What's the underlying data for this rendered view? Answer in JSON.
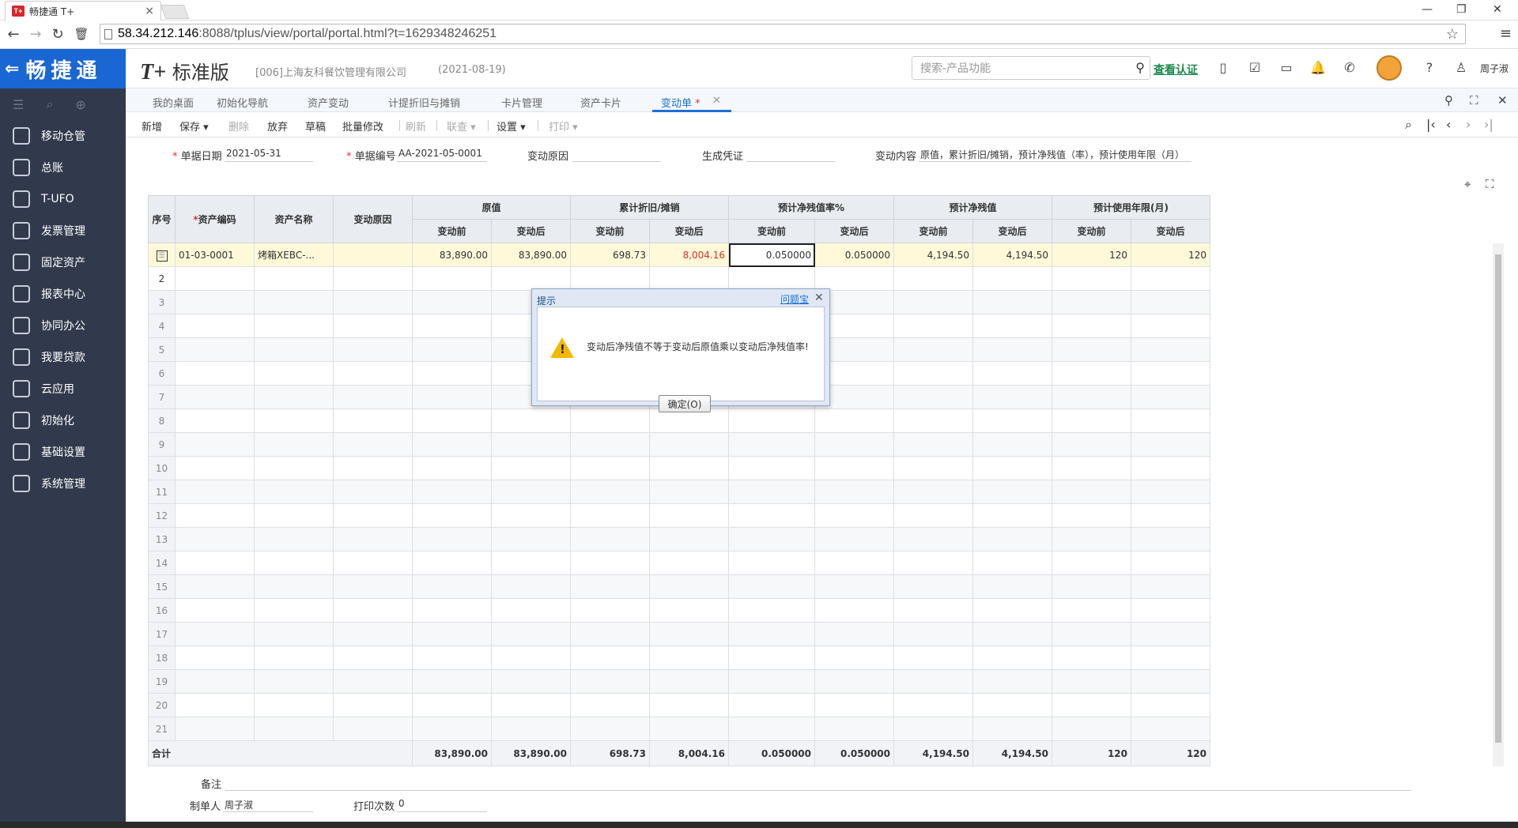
{
  "browser": {
    "tab_title": "畅捷通 T+",
    "favicon_text": "T+",
    "url_host": "58.34.212.146",
    "url_rest": ":8088/tplus/view/portal/portal.html?t=1629348246251"
  },
  "sidebar": {
    "logo": "畅捷通",
    "items": [
      {
        "label": "移动仓管",
        "icon": "warehouse-icon"
      },
      {
        "label": "总账",
        "icon": "ledger-icon"
      },
      {
        "label": "T-UFO",
        "icon": "ufo-icon"
      },
      {
        "label": "发票管理",
        "icon": "invoice-icon"
      },
      {
        "label": "固定资产",
        "icon": "bank-icon"
      },
      {
        "label": "报表中心",
        "icon": "chart-icon"
      },
      {
        "label": "协同办公",
        "icon": "collab-icon"
      },
      {
        "label": "我要贷款",
        "icon": "money-icon"
      },
      {
        "label": "云应用",
        "icon": "cloud-icon"
      },
      {
        "label": "初始化",
        "icon": "refresh-icon"
      },
      {
        "label": "基础设置",
        "icon": "settings-icon"
      },
      {
        "label": "系统管理",
        "icon": "monitor-icon"
      }
    ]
  },
  "header": {
    "product_t": "T+",
    "product_name": "标准版",
    "company": "[006]上海友科餐饮管理有限公司",
    "date": "(2021-08-19)",
    "search_placeholder": "搜索-产品功能",
    "verify": "查看认证",
    "user": "周子淑"
  },
  "worktabs": {
    "tabs": [
      "我的桌面",
      "初始化导航",
      "资产变动",
      "计提折旧与摊销",
      "卡片管理",
      "资产卡片",
      "变动单"
    ],
    "active_star": "*"
  },
  "toolbar": {
    "new": "新增",
    "save": "保存",
    "delete": "删除",
    "discard": "放弃",
    "draft": "草稿",
    "batch_edit": "批量修改",
    "refresh": "刷新",
    "link": "联查",
    "settings": "设置",
    "print": "打印"
  },
  "form": {
    "date_label": "单据日期",
    "date_value": "2021-05-31",
    "code_label": "单据编号",
    "code_value": "AA-2021-05-0001",
    "reason_label": "变动原因",
    "voucher_label": "生成凭证",
    "content_label": "变动内容",
    "content_value": "原值，累计折旧/摊销，预计净残值（率），预计使用年限（月）"
  },
  "grid": {
    "headers": {
      "seq": "序号",
      "code": "资产编码",
      "name": "资产名称",
      "reason": "变动原因",
      "g1": "原值",
      "g2": "累计折旧/摊销",
      "g3": "预计净残值率%",
      "g4": "预计净残值",
      "g5": "预计使用年限(月)",
      "before": "变动前",
      "after": "变动后"
    },
    "row1": {
      "code": "01-03-0001",
      "name": "烤箱XEBC-...",
      "reason": "",
      "orig_before": "83,890.00",
      "orig_after": "83,890.00",
      "dep_before": "698.73",
      "dep_after": "8,004.16",
      "rate_before": "0.050000",
      "rate_after": "0.050000",
      "res_before": "4,194.50",
      "res_after": "4,194.50",
      "life_before": "120",
      "life_after": "120"
    },
    "empty_rows": [
      "2",
      "3",
      "4",
      "5",
      "6",
      "7",
      "8",
      "9",
      "10",
      "11",
      "12",
      "13",
      "14",
      "15",
      "16",
      "17",
      "18",
      "19",
      "20",
      "21"
    ],
    "total": {
      "label": "合计",
      "orig_before": "83,890.00",
      "orig_after": "83,890.00",
      "dep_before": "698.73",
      "dep_after": "8,004.16",
      "rate_before": "0.050000",
      "rate_after": "0.050000",
      "res_before": "4,194.50",
      "res_after": "4,194.50",
      "life_before": "120",
      "life_after": "120"
    }
  },
  "footer": {
    "remark_label": "备注",
    "maker_label": "制单人",
    "maker_value": "周子淑",
    "print_count_label": "打印次数",
    "print_count_value": "0"
  },
  "dialog": {
    "title": "提示",
    "help": "问题宝",
    "message": "变动后净残值不等于变动后原值乘以变动后净残值率!",
    "ok": "确定(O)"
  }
}
